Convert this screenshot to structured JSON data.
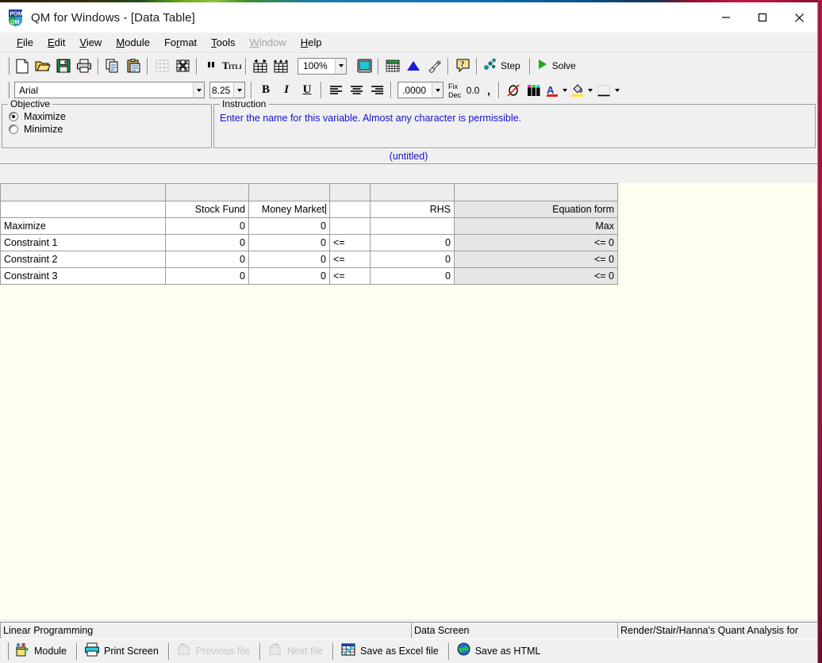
{
  "window": {
    "title": "QM for Windows - [Data Table]",
    "app_icon": "pom-qm-logo-icon",
    "controls": {
      "minimize": "minimize-icon",
      "maximize": "maximize-icon",
      "close": "close-icon"
    }
  },
  "menu": {
    "items": [
      {
        "label": "File",
        "accel": "F",
        "disabled": false
      },
      {
        "label": "Edit",
        "accel": "E",
        "disabled": false
      },
      {
        "label": "View",
        "accel": "V",
        "disabled": false
      },
      {
        "label": "Module",
        "accel": "M",
        "disabled": false
      },
      {
        "label": "Format",
        "accel": "r",
        "disabled": false
      },
      {
        "label": "Tools",
        "accel": "T",
        "disabled": false
      },
      {
        "label": "Window",
        "accel": "W",
        "disabled": true
      },
      {
        "label": "Help",
        "accel": "H",
        "disabled": false
      }
    ]
  },
  "toolbar_main": {
    "buttons": [
      {
        "name": "new-file-icon",
        "tip": "New",
        "disabled": false
      },
      {
        "name": "open-file-icon",
        "tip": "Open",
        "disabled": false
      },
      {
        "name": "save-file-icon",
        "tip": "Save",
        "disabled": false
      },
      {
        "name": "print-icon",
        "tip": "Print",
        "disabled": false
      },
      {
        "name": "copy-icon",
        "tip": "Copy",
        "disabled": false
      },
      {
        "name": "paste-icon",
        "tip": "Paste",
        "disabled": false
      },
      {
        "name": "delete-table-icon",
        "tip": "Delete table",
        "disabled": true
      },
      {
        "name": "edit-table-icon",
        "tip": "Edit table",
        "disabled": false
      },
      {
        "name": "pause-icon",
        "tip": "Pause",
        "disabled": false
      },
      {
        "name": "title-text-icon",
        "tip": "Title",
        "disabled": false
      },
      {
        "name": "insert-column-icon",
        "tip": "Insert column",
        "disabled": false
      },
      {
        "name": "insert-row-icon",
        "tip": "Insert row",
        "disabled": false
      }
    ],
    "zoom": {
      "value": "100%",
      "name": "zoom-combo"
    },
    "buttons2": [
      {
        "name": "full-screen-icon",
        "tip": "Full screen",
        "disabled": false
      },
      {
        "name": "data-table-icon",
        "tip": "Data table",
        "disabled": false
      },
      {
        "name": "graph-icon",
        "tip": "Graph",
        "disabled": false
      },
      {
        "name": "annotate-icon",
        "tip": "Annotate",
        "disabled": false
      },
      {
        "name": "help-question-icon",
        "tip": "Help",
        "disabled": false
      }
    ],
    "step_label": "Step",
    "step_icon": "step-dots-icon",
    "solve_label": "Solve",
    "solve_icon": "solve-play-icon"
  },
  "toolbar_format": {
    "font": {
      "value": "Arial",
      "name": "font-family-combo"
    },
    "size": {
      "value": "8.25",
      "name": "font-size-combo"
    },
    "bold": "B",
    "italic": "I",
    "underline": "U",
    "align": [
      "align-left-icon",
      "align-center-icon",
      "align-right-icon"
    ],
    "decimals": {
      "value": ".0000",
      "name": "decimals-combo"
    },
    "fix_dec_label_top": "Fix",
    "fix_dec_label_bottom": "Dec",
    "zero_dec_label": "0.0",
    "comma_label": ",",
    "no_color_icon": "no-color-icon",
    "color_palette_icon": "color-markers-icon",
    "font_color_icon": "font-color-icon",
    "fill_color_icon": "fill-color-icon",
    "borders_icon": "borders-icon"
  },
  "objective": {
    "legend": "Objective",
    "options": [
      {
        "label": "Maximize",
        "selected": true
      },
      {
        "label": "Minimize",
        "selected": false
      }
    ]
  },
  "instruction": {
    "legend": "Instruction",
    "text": "Enter the name for this variable. Almost any character is permissible."
  },
  "document": {
    "title": "(untitled)"
  },
  "grid": {
    "column_headers": [
      "",
      "Stock Fund",
      "Money Market",
      "",
      "RHS",
      "Equation form"
    ],
    "editing_cell": "Money Market",
    "rows": [
      {
        "label": "Maximize",
        "stock_fund": "0",
        "money_market": "0",
        "sign": "",
        "rhs": "",
        "equation_form": "Max"
      },
      {
        "label": "Constraint 1",
        "stock_fund": "0",
        "money_market": "0",
        "sign": "<=",
        "rhs": "0",
        "equation_form": "<= 0"
      },
      {
        "label": "Constraint 2",
        "stock_fund": "0",
        "money_market": "0",
        "sign": "<=",
        "rhs": "0",
        "equation_form": "<= 0"
      },
      {
        "label": "Constraint 3",
        "stock_fund": "0",
        "money_market": "0",
        "sign": "<=",
        "rhs": "0",
        "equation_form": "<= 0"
      }
    ]
  },
  "status_bar": {
    "left": "Linear Programming",
    "middle": "Data Screen",
    "right": "Render/Stair/Hanna's Quant Analysis for"
  },
  "bottom_bar": {
    "buttons": [
      {
        "label": "Module",
        "icon": "module-icon",
        "disabled": false
      },
      {
        "label": "Print Screen",
        "icon": "print-screen-icon",
        "disabled": false
      },
      {
        "label": "Previous file",
        "icon": "previous-file-icon",
        "disabled": true
      },
      {
        "label": "Next file",
        "icon": "next-file-icon",
        "disabled": true
      },
      {
        "label": "Save as Excel file",
        "icon": "excel-file-icon",
        "disabled": false
      },
      {
        "label": "Save as HTML",
        "icon": "html-globe-icon",
        "disabled": false
      }
    ]
  },
  "colors": {
    "instruction_blue": "#1414c8",
    "window_chrome": "#f0f0f0",
    "grid_background": "#fffff0",
    "equation_column": "#e6e6e6",
    "accent_red": "#b31340"
  }
}
